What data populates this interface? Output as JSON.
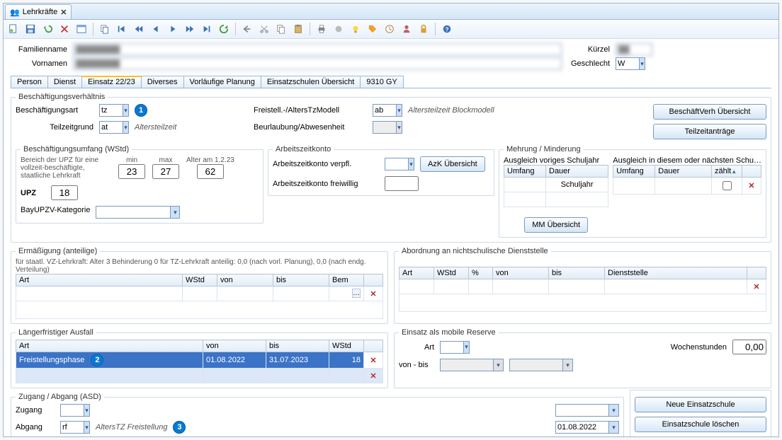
{
  "tabTitle": "Lehrkräfte",
  "header": {
    "familienname_label": "Familienname",
    "familienname_value": "████████",
    "vornamen_label": "Vornamen",
    "vornamen_value": "████████",
    "kuerzel_label": "Kürzel",
    "kuerzel_value": "██",
    "geschlecht_label": "Geschlecht",
    "geschlecht_value": "W"
  },
  "tabs": [
    "Person",
    "Dienst",
    "Einsatz 22/23",
    "Diverses",
    "Vorläufige Planung",
    "Einsatzschulen Übersicht",
    "9310 GY"
  ],
  "activeTab": "Einsatz 22/23",
  "grp_beschaeftigung_title": "Beschäftigungsverhältnis",
  "beschaeftigungsart_label": "Beschäftigungsart",
  "beschaeftigungsart_value": "tz",
  "freistell_label": "Freistell.-/AltersTzModell",
  "freistell_value": "ab",
  "freistell_hint": "Altersteilzeit Blockmodell",
  "teilzeitgrund_label": "Teilzeitgrund",
  "teilzeitgrund_value": "at",
  "teilzeitgrund_hint": "Altersteilzeit",
  "beurlaubung_label": "Beurlaubung/Abwesenheit",
  "beurlaubung_value": "",
  "btn_beschaeftverh": "BeschäftVerh Übersicht",
  "btn_teilzeitantraege": "Teilzeitanträge",
  "grp_umfang_title": "Beschäftigungsumfang (WStd)",
  "umfang_note": "Bereich der UPZ für eine vollzeit-beschäftigte, staatliche Lehrkraft",
  "min_label": "min",
  "min_value": "23",
  "max_label": "max",
  "max_value": "27",
  "alter_label": "Alter am 1.2.23",
  "alter_value": "62",
  "upz_label": "UPZ",
  "upz_value": "18",
  "bayupzv_label": "BayUPZV-Kategorie",
  "bayupzv_value": "",
  "grp_azk_title": "Arbeitszeitkonto",
  "azk_verpfl_label": "Arbeitszeitkonto verpfl.",
  "azk_verpfl_value": "",
  "azk_freiw_label": "Arbeitszeitkonto freiwillig",
  "azk_freiw_value": "",
  "btn_azk": "AzK Übersicht",
  "grp_mehrung_title": "Mehrung / Minderung",
  "mehrung_left_caption": "Ausgleich voriges Schuljahr",
  "mehrung_right_caption": "Ausgleich in diesem oder nächsten Schu…",
  "col_umfang": "Umfang",
  "col_dauer": "Dauer",
  "col_schuljahr": "Schuljahr",
  "col_zaehlt": "zählt",
  "btn_mm": "MM Übersicht",
  "grp_erm_title": "Ermäßigung (anteilige)",
  "erm_note": "für staatl. VZ-Lehrkraft: Alter 3 Behinderung 0     für TZ-Lehrkraft anteilig: 0,0 (nach vorl. Planung), 0,0 (nach endg. Verteilung)",
  "erm_cols": [
    "Art",
    "WStd",
    "von",
    "bis",
    "Bem"
  ],
  "grp_abord_title": "Abordnung an nichtschulische Dienststelle",
  "abord_cols": [
    "Art",
    "WStd",
    "%",
    "von",
    "bis",
    "Dienststelle"
  ],
  "grp_ausfall_title": "Längerfristiger Ausfall",
  "ausfall_cols": [
    "Art",
    "von",
    "bis",
    "WStd"
  ],
  "ausfall_row": {
    "art": "Freistellungsphase",
    "von": "01.08.2022",
    "bis": "31.07.2023",
    "wstd": "18"
  },
  "grp_mobile_title": "Einsatz als mobile Reserve",
  "mobile_art_label": "Art",
  "mobile_art_value": "",
  "mobile_wochenstd_label": "Wochenstunden",
  "mobile_wochenstd_value": "0,00",
  "mobile_vonbis_label": "von - bis",
  "grp_zugangabgang_title": "Zugang / Abgang (ASD)",
  "zugang_label": "Zugang",
  "zugang_value": "",
  "abgang_label": "Abgang",
  "abgang_value": "rf",
  "abgang_hint": "AltersTZ Freistellung",
  "abgang_date": "01.08.2022",
  "btn_neue_einsatzschule": "Neue Einsatzschule",
  "btn_einsatzschule_loeschen": "Einsatzschule löschen",
  "markers": {
    "m1": "1",
    "m2": "2",
    "m3": "3"
  }
}
